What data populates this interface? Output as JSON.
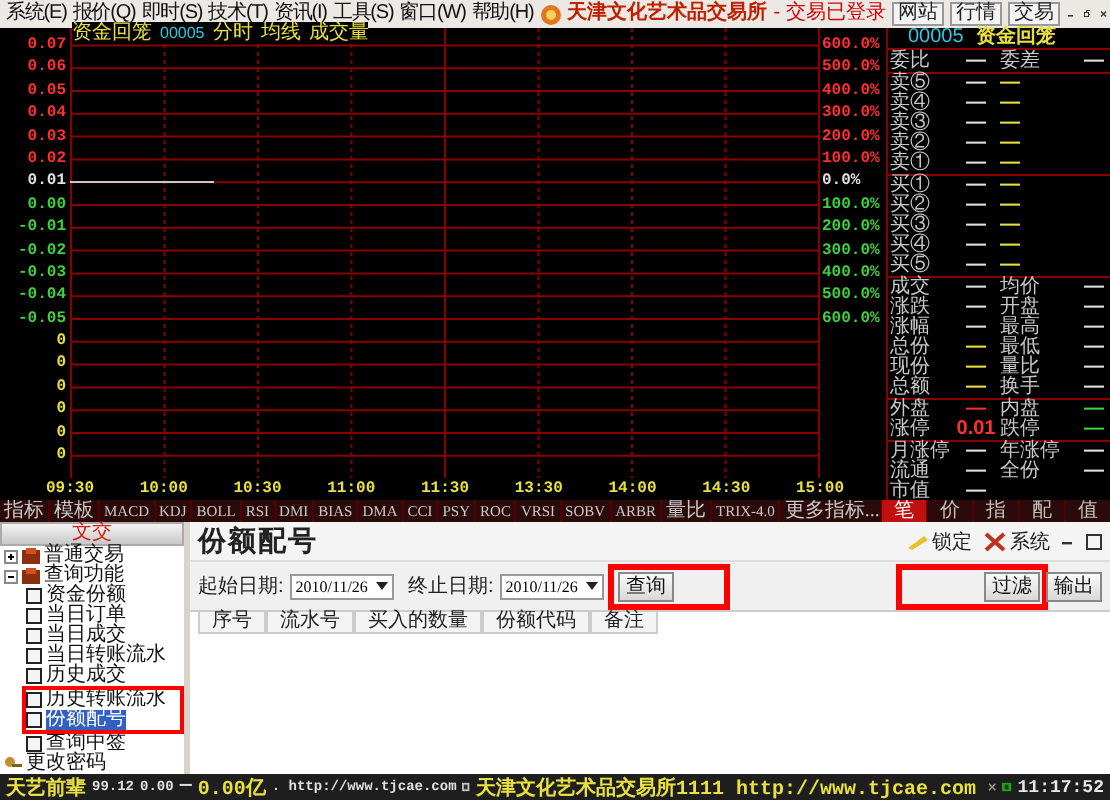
{
  "menu_bar": {
    "items": [
      "系统(E)",
      "报价(Q)",
      "即时(S)",
      "技术(T)",
      "资讯(I)",
      "工具(S)",
      "窗口(W)",
      "帮助(H)"
    ],
    "title": "天津文化艺术品交易所",
    "status": "- 交易已登录",
    "buttons": [
      "网站",
      "行情",
      "交易"
    ]
  },
  "chart": {
    "name": "资金回笼",
    "code": "00005",
    "labels": [
      "分时",
      "均线",
      "成交量"
    ],
    "left_axis": [
      {
        "label": "0.07",
        "color": "#ff3030"
      },
      {
        "label": "0.06",
        "color": "#ff3030"
      },
      {
        "label": "0.05",
        "color": "#ff3030"
      },
      {
        "label": "0.04",
        "color": "#ff3030"
      },
      {
        "label": "0.03",
        "color": "#ff3030"
      },
      {
        "label": "0.02",
        "color": "#ff3030"
      },
      {
        "label": "0.01",
        "color": "#e0e0e0"
      },
      {
        "label": "0.00",
        "color": "#40d040"
      },
      {
        "label": "-0.01",
        "color": "#40d040"
      },
      {
        "label": "-0.02",
        "color": "#40d040"
      },
      {
        "label": "-0.03",
        "color": "#40d040"
      },
      {
        "label": "-0.04",
        "color": "#40d040"
      },
      {
        "label": "-0.05",
        "color": "#40d040"
      },
      {
        "label": "0",
        "color": "#e8e040"
      },
      {
        "label": "0",
        "color": "#e8e040"
      },
      {
        "label": "0",
        "color": "#e8e040"
      },
      {
        "label": "0",
        "color": "#e8e040"
      },
      {
        "label": "0",
        "color": "#e8e040"
      },
      {
        "label": "0",
        "color": "#e8e040"
      }
    ],
    "right_axis": [
      {
        "label": "600.0%",
        "color": "#ff3030"
      },
      {
        "label": "500.0%",
        "color": "#ff3030"
      },
      {
        "label": "400.0%",
        "color": "#ff3030"
      },
      {
        "label": "300.0%",
        "color": "#ff3030"
      },
      {
        "label": "200.0%",
        "color": "#ff3030"
      },
      {
        "label": "100.0%",
        "color": "#ff3030"
      },
      {
        "label": "0.0%",
        "color": "#e0e0e0"
      },
      {
        "label": "100.0%",
        "color": "#40d040"
      },
      {
        "label": "200.0%",
        "color": "#40d040"
      },
      {
        "label": "300.0%",
        "color": "#40d040"
      },
      {
        "label": "400.0%",
        "color": "#40d040"
      },
      {
        "label": "500.0%",
        "color": "#40d040"
      },
      {
        "label": "600.0%",
        "color": "#40d040"
      }
    ],
    "time_axis": [
      "09:30",
      "10:00",
      "10:30",
      "11:00",
      "11:30",
      "13:30",
      "14:00",
      "14:30",
      "15:00"
    ]
  },
  "indicators": [
    "指标",
    "模板",
    "MACD",
    "KDJ",
    "BOLL",
    "RSI",
    "DMI",
    "BIAS",
    "DMA",
    "CCI",
    "PSY",
    "ROC",
    "VRSI",
    "SOBV",
    "ARBR",
    "量比",
    "TRIX-4.0",
    "更多指标..."
  ],
  "quote_panel": {
    "code": "00005",
    "name": "资金回笼",
    "groups": [
      [
        {
          "cells": [
            {
              "text": "委比",
              "color": "#c8c8c8"
            },
            {
              "text": "—",
              "color": "#e0e0e0"
            },
            {
              "text": "委差",
              "color": "#c8c8c8"
            },
            {
              "text": "—",
              "color": "#e0e0e0"
            }
          ]
        }
      ],
      [
        {
          "cells": [
            {
              "text": "卖⑤",
              "color": "#c8c8c8"
            },
            {
              "text": "—",
              "color": "#e0e0e0"
            },
            {
              "text": "—",
              "color": "#e8e040"
            }
          ]
        },
        {
          "cells": [
            {
              "text": "卖④",
              "color": "#c8c8c8"
            },
            {
              "text": "—",
              "color": "#e0e0e0"
            },
            {
              "text": "—",
              "color": "#e8e040"
            }
          ]
        },
        {
          "cells": [
            {
              "text": "卖③",
              "color": "#c8c8c8"
            },
            {
              "text": "—",
              "color": "#e0e0e0"
            },
            {
              "text": "—",
              "color": "#e8e040"
            }
          ]
        },
        {
          "cells": [
            {
              "text": "卖②",
              "color": "#c8c8c8"
            },
            {
              "text": "—",
              "color": "#e0e0e0"
            },
            {
              "text": "—",
              "color": "#e8e040"
            }
          ]
        },
        {
          "cells": [
            {
              "text": "卖①",
              "color": "#c8c8c8"
            },
            {
              "text": "—",
              "color": "#e0e0e0"
            },
            {
              "text": "—",
              "color": "#e8e040"
            }
          ]
        }
      ],
      [
        {
          "cells": [
            {
              "text": "买①",
              "color": "#c8c8c8"
            },
            {
              "text": "—",
              "color": "#e0e0e0"
            },
            {
              "text": "—",
              "color": "#e8e040"
            }
          ]
        },
        {
          "cells": [
            {
              "text": "买②",
              "color": "#c8c8c8"
            },
            {
              "text": "—",
              "color": "#e0e0e0"
            },
            {
              "text": "—",
              "color": "#e8e040"
            }
          ]
        },
        {
          "cells": [
            {
              "text": "买③",
              "color": "#c8c8c8"
            },
            {
              "text": "—",
              "color": "#e0e0e0"
            },
            {
              "text": "—",
              "color": "#e8e040"
            }
          ]
        },
        {
          "cells": [
            {
              "text": "买④",
              "color": "#c8c8c8"
            },
            {
              "text": "—",
              "color": "#e0e0e0"
            },
            {
              "text": "—",
              "color": "#e8e040"
            }
          ]
        },
        {
          "cells": [
            {
              "text": "买⑤",
              "color": "#c8c8c8"
            },
            {
              "text": "—",
              "color": "#e0e0e0"
            },
            {
              "text": "—",
              "color": "#e8e040"
            }
          ]
        }
      ],
      [
        {
          "cells": [
            {
              "text": "成交",
              "color": "#c8c8c8"
            },
            {
              "text": "—",
              "color": "#e0e0e0"
            },
            {
              "text": "均价",
              "color": "#c8c8c8"
            },
            {
              "text": "—",
              "color": "#e0e0e0"
            }
          ]
        },
        {
          "cells": [
            {
              "text": "涨跌",
              "color": "#c8c8c8"
            },
            {
              "text": "—",
              "color": "#e0e0e0"
            },
            {
              "text": "开盘",
              "color": "#c8c8c8"
            },
            {
              "text": "—",
              "color": "#e0e0e0"
            }
          ]
        },
        {
          "cells": [
            {
              "text": "涨幅",
              "color": "#c8c8c8"
            },
            {
              "text": "—",
              "color": "#e0e0e0"
            },
            {
              "text": "最高",
              "color": "#c8c8c8"
            },
            {
              "text": "—",
              "color": "#e0e0e0"
            }
          ]
        },
        {
          "cells": [
            {
              "text": "总份",
              "color": "#c8c8c8"
            },
            {
              "text": "—",
              "color": "#e8e040"
            },
            {
              "text": "最低",
              "color": "#c8c8c8"
            },
            {
              "text": "—",
              "color": "#e0e0e0"
            }
          ]
        },
        {
          "cells": [
            {
              "text": "现份",
              "color": "#c8c8c8"
            },
            {
              "text": "—",
              "color": "#e8e040"
            },
            {
              "text": "量比",
              "color": "#c8c8c8"
            },
            {
              "text": "—",
              "color": "#e0e0e0"
            }
          ]
        },
        {
          "cells": [
            {
              "text": "总额",
              "color": "#c8c8c8"
            },
            {
              "text": "—",
              "color": "#e8e040"
            },
            {
              "text": "换手",
              "color": "#c8c8c8"
            },
            {
              "text": "—",
              "color": "#e0e0e0"
            }
          ]
        }
      ],
      [
        {
          "cells": [
            {
              "text": "外盘",
              "color": "#c8c8c8"
            },
            {
              "text": "—",
              "color": "#ff3030"
            },
            {
              "text": "内盘",
              "color": "#c8c8c8"
            },
            {
              "text": "—",
              "color": "#40d040"
            }
          ]
        },
        {
          "cells": [
            {
              "text": "涨停",
              "color": "#c8c8c8"
            },
            {
              "text": "0.01",
              "color": "#ff3030"
            },
            {
              "text": "跌停",
              "color": "#c8c8c8"
            },
            {
              "text": "—",
              "color": "#40d040"
            }
          ]
        }
      ],
      [
        {
          "cells": [
            {
              "text": "月涨停",
              "color": "#c8c8c8"
            },
            {
              "text": "—",
              "color": "#e0e0e0"
            },
            {
              "text": "年涨停",
              "color": "#c8c8c8"
            },
            {
              "text": "—",
              "color": "#e0e0e0"
            }
          ]
        },
        {
          "cells": [
            {
              "text": "流通",
              "color": "#c8c8c8"
            },
            {
              "text": "—",
              "color": "#e0e0e0"
            },
            {
              "text": "全份",
              "color": "#c8c8c8"
            },
            {
              "text": "—",
              "color": "#e0e0e0"
            }
          ]
        },
        {
          "cells": [
            {
              "text": "市值",
              "color": "#c8c8c8"
            },
            {
              "text": "—",
              "color": "#e0e0e0"
            }
          ]
        }
      ]
    ],
    "tabs": [
      {
        "label": "笔",
        "selected": true
      },
      {
        "label": "价",
        "selected": false
      },
      {
        "label": "指",
        "selected": false
      },
      {
        "label": "配",
        "selected": false
      },
      {
        "label": "值",
        "selected": false
      }
    ]
  },
  "tree": {
    "header": "文交",
    "items": [
      {
        "label": "普通交易",
        "expanded": false,
        "selected": false
      },
      {
        "label": "查询功能",
        "expanded": true,
        "selected": false,
        "children": [
          {
            "label": "资金份额",
            "selected": false
          },
          {
            "label": "当日订单",
            "selected": false
          },
          {
            "label": "当日成交",
            "selected": false
          },
          {
            "label": "当日转账流水",
            "selected": false
          },
          {
            "label": "历史成交",
            "selected": false
          },
          {
            "label": "历史转账流水",
            "selected": false,
            "highlighted": true
          },
          {
            "label": "份额配号",
            "selected": true,
            "highlighted": true
          },
          {
            "label": "查询中签",
            "selected": false
          }
        ]
      },
      {
        "label": "更改密码",
        "selected": false
      }
    ]
  },
  "content": {
    "title": "份额配号",
    "tools": [
      {
        "label": "锁定",
        "kind": "lock"
      },
      {
        "label": "系统",
        "kind": "system"
      }
    ],
    "filters": [
      {
        "label": "起始日期:",
        "value": "2010/11/26"
      },
      {
        "label": "终止日期:",
        "value": "2010/11/26"
      }
    ],
    "query_button": {
      "label": "查询",
      "highlighted": true
    },
    "buttons": [
      {
        "label": "过滤",
        "highlighted": true
      },
      {
        "label": "输出"
      }
    ],
    "columns": [
      "序号",
      "流水号",
      "买入的数量",
      "份额代码",
      "备注"
    ]
  },
  "status_bar": {
    "items": [
      {
        "text": "天艺前辈",
        "color": "#e8e040"
      },
      {
        "text": "99.12",
        "color": "#e0e0e0"
      },
      {
        "text": "0.00",
        "color": "#e0e0e0"
      },
      {
        "text": "—",
        "color": "#e0e0e0"
      },
      {
        "text": "0.00亿",
        "color": "#e8e040"
      },
      {
        "text": ". http://www.tjcae.com",
        "color": "#e0e0e0"
      },
      {
        "text": "天津文化艺术品交易所1111 http://www.tjcae.com",
        "color": "#e8e040"
      }
    ],
    "time": "11:17:52"
  }
}
